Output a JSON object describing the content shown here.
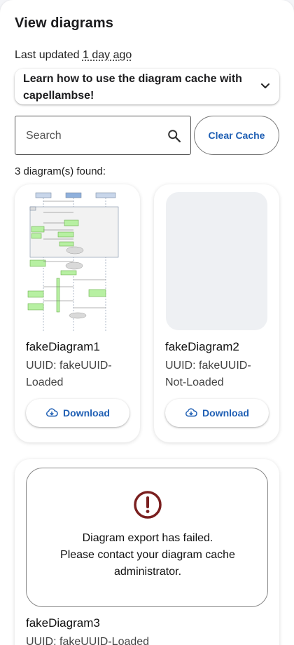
{
  "header": {
    "title": "View diagrams",
    "updated_prefix": "Last updated",
    "updated_relative": "1 day ago"
  },
  "accordion": {
    "label": "Learn how to use the diagram cache with capellambse!",
    "icon": "chevron-down-icon"
  },
  "search": {
    "placeholder": "Search",
    "value": "",
    "icon": "search-icon"
  },
  "clear_cache_label": "Clear Cache",
  "results_count": "3 diagram(s) found:",
  "colors": {
    "accent": "#1f5fb4",
    "error": "#7a1f1f",
    "placeholder_bg": "#eef0f3"
  },
  "diagrams": [
    {
      "name": "fakeDiagram1",
      "uuid": "UUID: fakeUUID-Loaded",
      "status": "loaded",
      "download_label": "Download",
      "download_icon": "cloud-download-icon"
    },
    {
      "name": "fakeDiagram2",
      "uuid": "UUID: fakeUUID-Not-Loaded",
      "status": "loading",
      "download_label": "Download",
      "download_icon": "cloud-download-icon"
    },
    {
      "name": "fakeDiagram3",
      "uuid": "UUID: fakeUUID-Loaded",
      "status": "error",
      "error_icon": "error-icon",
      "error_line1": "Diagram export has failed.",
      "error_line2": "Please contact your diagram cache",
      "error_line3": "administrator."
    }
  ]
}
